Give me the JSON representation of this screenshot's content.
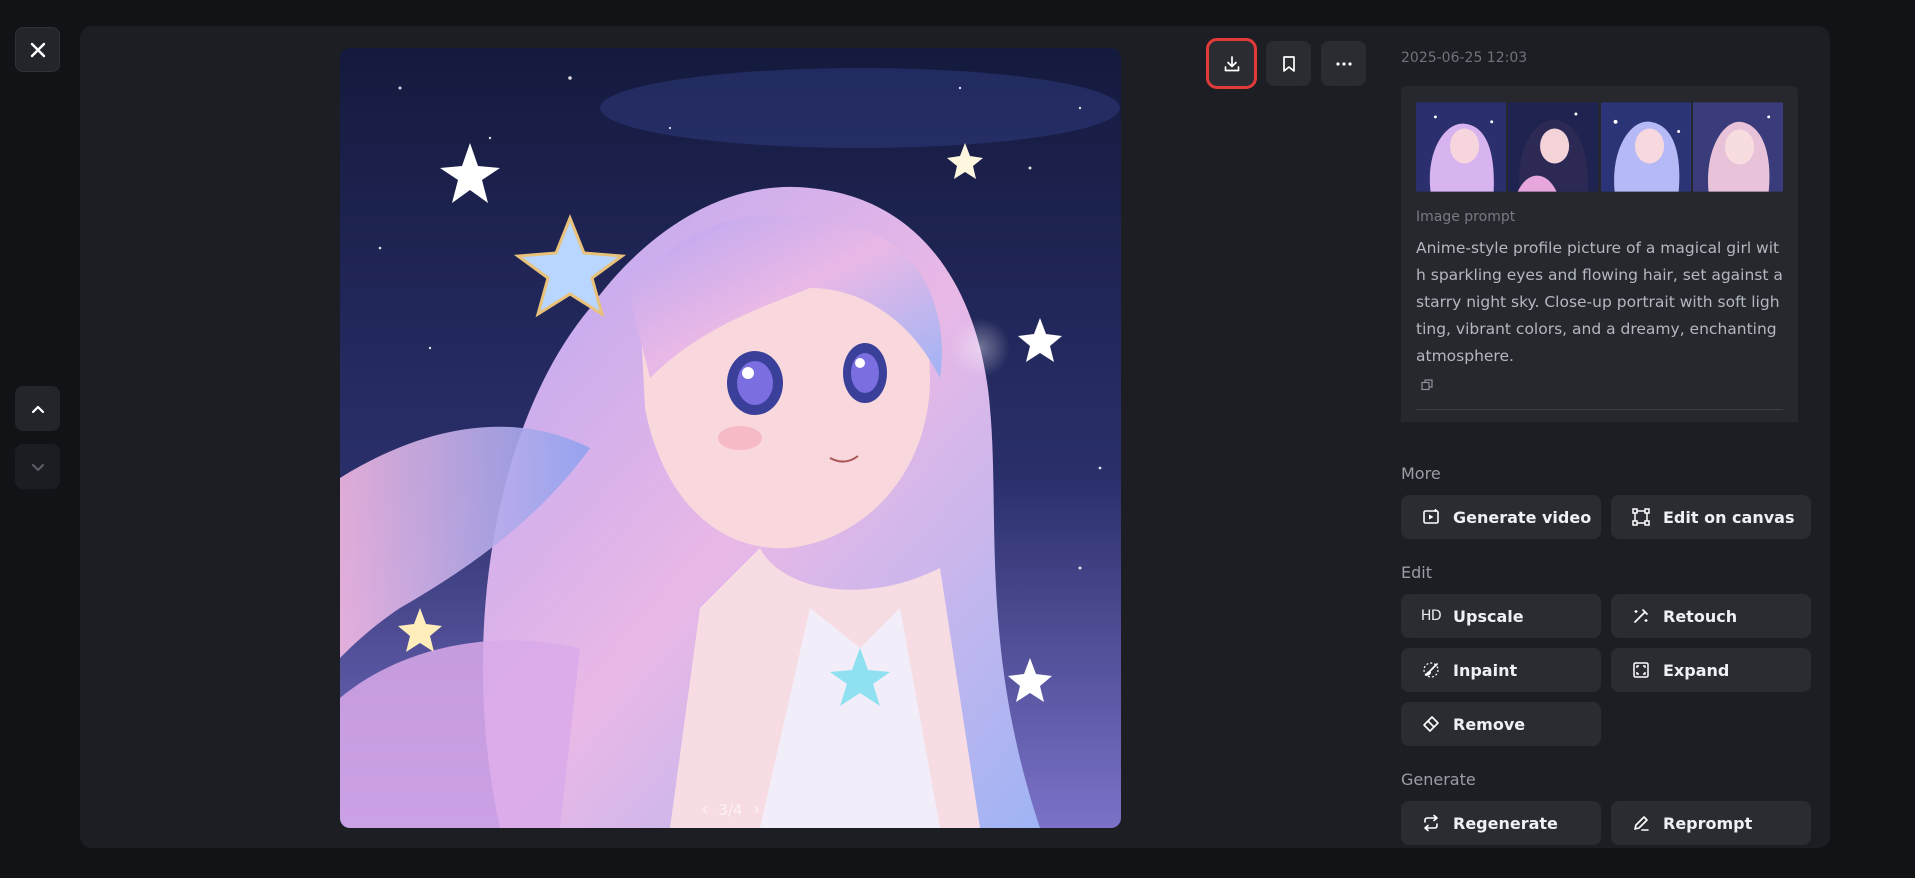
{
  "nav": {
    "close_icon": "close-icon",
    "prev_icon": "chevron-up-icon",
    "next_icon": "chevron-down-icon"
  },
  "toolbar": {
    "download_icon": "download-icon",
    "bookmark_icon": "bookmark-icon",
    "more_icon": "more-icon"
  },
  "viewer": {
    "pager_text": "3/4",
    "current_page": 3,
    "total_pages": 4
  },
  "info": {
    "timestamp": "2025-06-25 12:03",
    "prompt_label": "Image prompt",
    "prompt_text": "Anime-style profile picture of a magical girl with sparkling eyes and flowing hair, set against a starry night sky. Close-up portrait with soft lighting, vibrant colors, and a dreamy, enchanting atmosphere."
  },
  "sections": {
    "more": {
      "title": "More",
      "buttons": [
        {
          "label": "Generate video",
          "icon": "video-icon"
        },
        {
          "label": "Edit on canvas",
          "icon": "canvas-icon"
        }
      ]
    },
    "edit": {
      "title": "Edit",
      "buttons": [
        {
          "label": "Upscale",
          "icon": "HD"
        },
        {
          "label": "Retouch",
          "icon": "magic-wand-icon"
        },
        {
          "label": "Inpaint",
          "icon": "brush-icon"
        },
        {
          "label": "Expand",
          "icon": "expand-icon"
        },
        {
          "label": "Remove",
          "icon": "eraser-icon"
        }
      ]
    },
    "generate": {
      "title": "Generate",
      "buttons": [
        {
          "label": "Regenerate",
          "icon": "repeat-icon"
        },
        {
          "label": "Reprompt",
          "icon": "pencil-icon"
        }
      ]
    }
  },
  "colors": {
    "background": "#111317",
    "panel": "#1c1e23",
    "button": "#2a2c32",
    "highlight": "#e23a3a"
  }
}
